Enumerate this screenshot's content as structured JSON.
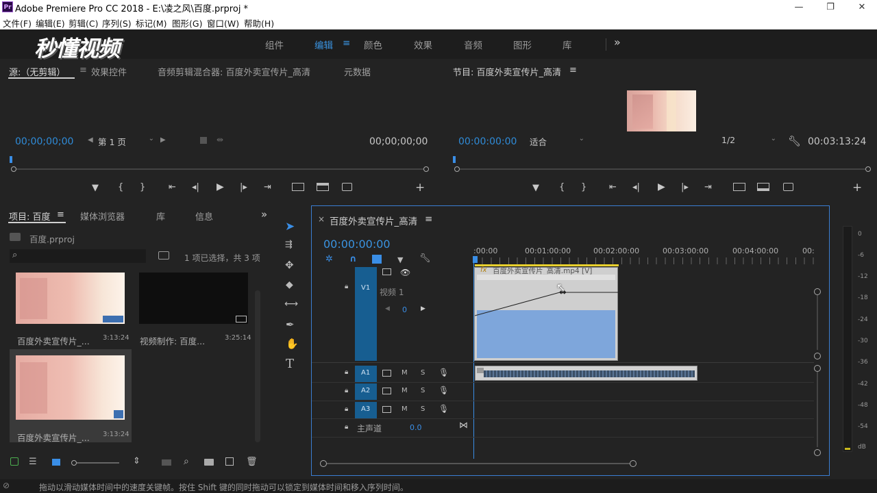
{
  "window": {
    "title": "Adobe Premiere Pro CC 2018 - E:\\凌之风\\百度.prproj *",
    "app_badge": "Pr",
    "minimize": "—",
    "restore": "❐",
    "close": "✕"
  },
  "menu": [
    "文件(F)",
    "编辑(E)",
    "剪辑(C)",
    "序列(S)",
    "标记(M)",
    "图形(G)",
    "窗口(W)",
    "帮助(H)"
  ],
  "watermark": "秒懂视频",
  "workspaces": {
    "items": [
      "组件",
      "编辑",
      "颜色",
      "效果",
      "音频",
      "图形",
      "库"
    ],
    "active": "编辑",
    "more": "»",
    "menu_icon": "≡"
  },
  "source_panel": {
    "tabs": [
      "源:（无剪辑）",
      "效果控件",
      "音频剪辑混合器: 百度外卖宣传片_高清",
      "元数据"
    ],
    "menu_icon": "≡",
    "timecode_in": "00;00;00;00",
    "page_select": "第 1 页",
    "timecode_out": "00;00;00;00"
  },
  "program_panel": {
    "title": "节目: 百度外卖宣传片_高清",
    "menu_icon": "≡",
    "timecode": "00:00:00:00",
    "fit_select": "适合",
    "resolution_select": "1/2",
    "duration": "00:03:13:24"
  },
  "transport_icons": {
    "marker": "▼",
    "in": "{",
    "out": "}",
    "go_in": "⇤",
    "step_back": "◂|",
    "play": "▶",
    "step_fwd": "|▸",
    "go_out": "⇥",
    "add": "+"
  },
  "project_panel": {
    "tabs": [
      "项目: 百度",
      "媒体浏览器",
      "库",
      "信息"
    ],
    "menu_icon": "≡",
    "more": "»",
    "file": "百度.prproj",
    "search_placeholder": "",
    "selection_info": "1 项已选择，共 3 项",
    "items": [
      {
        "name": "百度外卖宣传片_...",
        "duration": "3:13:24"
      },
      {
        "name": "视频制作: 百度...",
        "duration": "3:25:14"
      },
      {
        "name": "百度外卖宣传片_...",
        "duration": "3:13:24"
      }
    ]
  },
  "timeline": {
    "close": "×",
    "sequence_name": "百度外卖宣传片_高清",
    "menu_icon": "≡",
    "timecode": "00:00:00:00",
    "ruler": ":00:00",
    "ruler_labels": [
      ":00:00",
      "00:01:00:00",
      "00:02:00:00",
      "00:03:00:00",
      "00:04:00:00",
      "00:"
    ],
    "video_track": {
      "id": "V1",
      "name": "视频 1",
      "keyframe_value": "0"
    },
    "clip_label": "百度外卖宣传片_高清.mp4 [V]",
    "clip_fx": "fx",
    "audio_tracks": [
      {
        "id": "A1",
        "m": "M",
        "s": "S"
      },
      {
        "id": "A2",
        "m": "M",
        "s": "S"
      },
      {
        "id": "A3",
        "m": "M",
        "s": "S"
      }
    ],
    "master": {
      "label": "主声道",
      "value": "0.0"
    }
  },
  "meter_scale": [
    "0",
    "-6",
    "-12",
    "-18",
    "-24",
    "-30",
    "-36",
    "-42",
    "-48",
    "-54",
    "dB"
  ],
  "status_bar": "拖动以滑动媒体时间中的速度关键帧。按住 Shift 键的同时拖动可以锁定到媒体时间和移入序列时间。"
}
